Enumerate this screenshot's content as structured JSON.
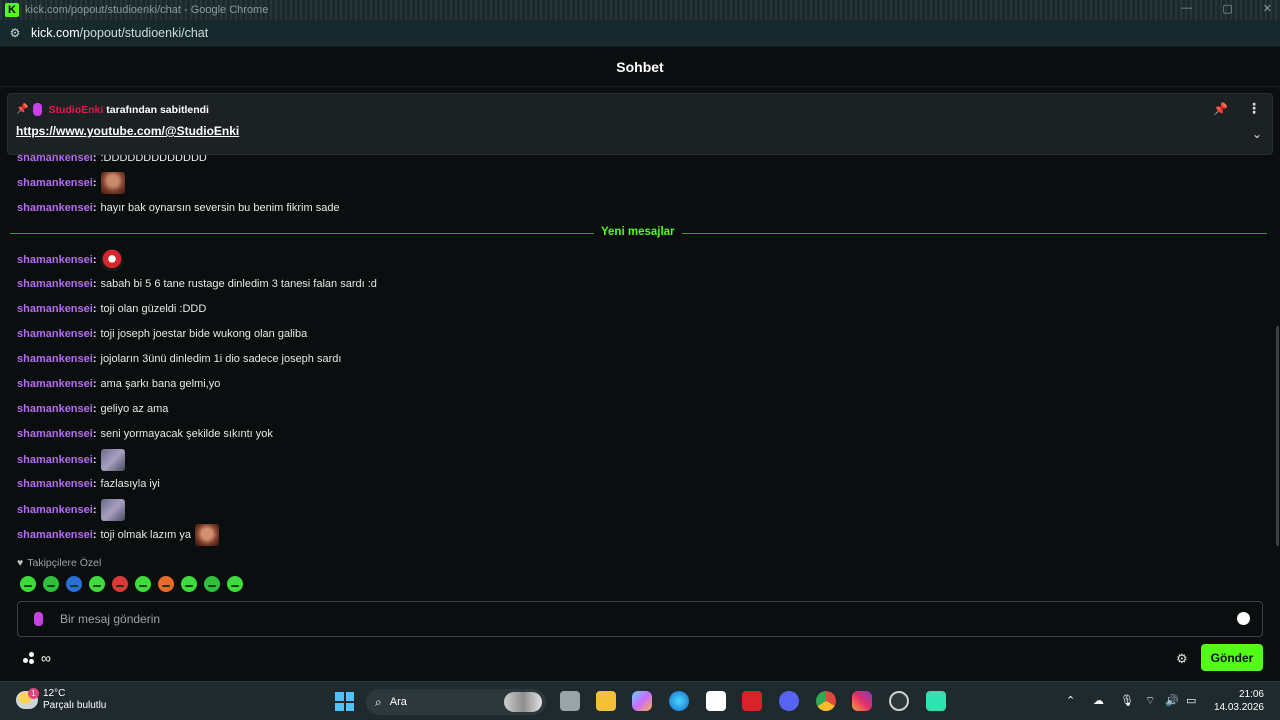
{
  "browser": {
    "window_title": "kick.com/popout/studioenki/chat - Google Chrome",
    "url_host": "kick.com",
    "url_path": "/popout/studioenki/chat"
  },
  "chat": {
    "header_title": "Sohbet",
    "pinned": {
      "pinner": "StudioEnki",
      "suffix": "tarafından sabitlendi",
      "link": "https://www.youtube.com/@StudioEnki"
    },
    "new_messages_label": "Yeni mesajlar",
    "messages": [
      {
        "user": "shamankensei",
        "text": ":DDDDDDDDDDDDD"
      },
      {
        "user": "shamankensei",
        "text": "",
        "emote": "face"
      },
      {
        "user": "shamankensei",
        "text": "hayır bak oynarsın seversin bu benim fikrim sade"
      },
      {
        "user": "shamankensei",
        "text": "",
        "emote": "ball"
      },
      {
        "user": "shamankensei",
        "text": "sabah bi 5 6 tane rustage dinledim 3 tanesi falan sardı :d"
      },
      {
        "user": "shamankensei",
        "text": "toji olan güzeldi :DDD"
      },
      {
        "user": "shamankensei",
        "text": "toji joseph joestar bide wukong olan galiba"
      },
      {
        "user": "shamankensei",
        "text": "jojoların 3ünü dinledim 1i dio sadece joseph sardı"
      },
      {
        "user": "shamankensei",
        "text": "ama şarkı bana gelmi,yo"
      },
      {
        "user": "shamankensei",
        "text": "geliyo az ama"
      },
      {
        "user": "shamankensei",
        "text": "seni yormayacak şekilde sıkıntı yok"
      },
      {
        "user": "shamankensei",
        "text": "",
        "emote": "blur"
      },
      {
        "user": "shamankensei",
        "text": "fazlasıyla iyi"
      },
      {
        "user": "shamankensei",
        "text": "",
        "emote": "blur"
      },
      {
        "user": "shamankensei",
        "text": "toji olmak lazım ya",
        "emote": "face2"
      }
    ],
    "followers_only_label": "Takipçilere Özel",
    "input_placeholder": "Bir mesaj gönderin",
    "send_label": "Gönder"
  },
  "taskbar": {
    "temperature": "12°C",
    "weather_desc": "Parçalı bulutlu",
    "weather_badge": "1",
    "search_label": "Ara",
    "time": "21:06",
    "date": "14.03.2026"
  }
}
